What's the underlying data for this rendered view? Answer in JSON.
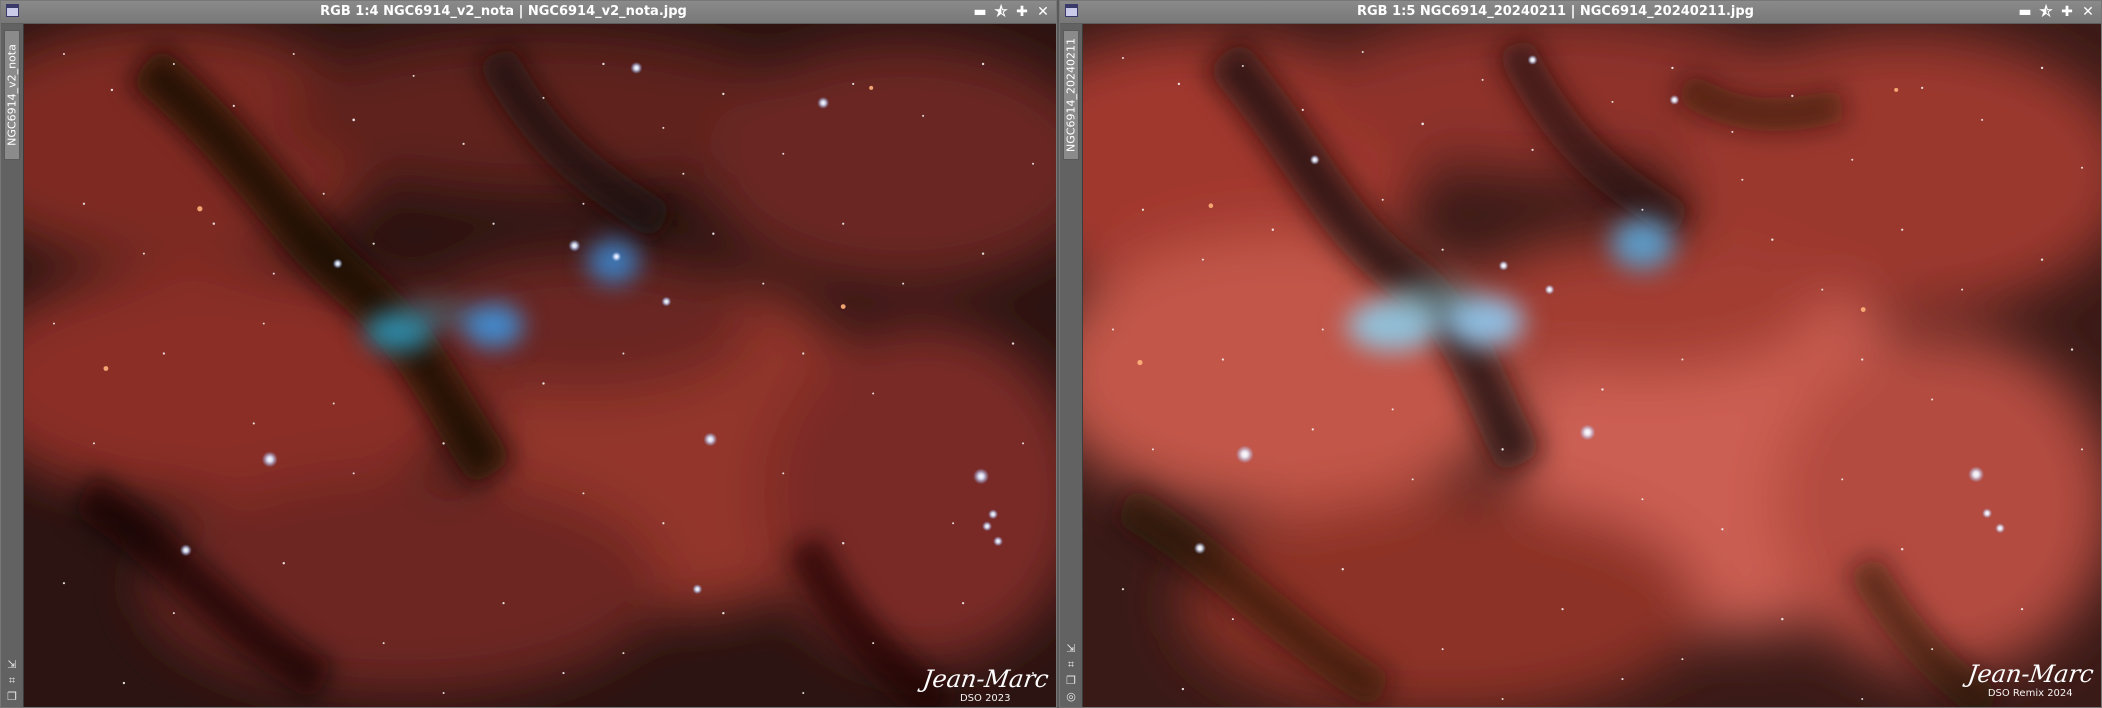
{
  "windows": [
    {
      "title": "RGB 1:4 NGC6914_v2_nota | NGC6914_v2_nota.jpg",
      "tab_label": "NGC6914_v2_nota",
      "signature": {
        "name": "Jean-Marc",
        "line": "DSO 2023"
      }
    },
    {
      "title": "RGB 1:5 NGC6914_20240211 | NGC6914_20240211.jpg",
      "tab_label": "NGC6914_20240211",
      "signature": {
        "name": "Jean-Marc",
        "line": "DSO Remix 2024"
      }
    }
  ],
  "controls": {
    "minimize": "▬",
    "shade": "⯪",
    "maximize": "✚",
    "close": "✕"
  },
  "icons": [
    "window-icon",
    "minimize-icon",
    "shade-icon",
    "maximize-icon",
    "close-icon",
    "tool-arrow-icon",
    "tool-fit-icon",
    "tool-copy-icon",
    "tool-eye-icon"
  ],
  "colors": {
    "titlebar": "#808080",
    "sidebar": "#626262",
    "nebula_red": "#a23a30",
    "nebula_bright": "#d8675a",
    "reflection_blue": "#4aa3d6",
    "dust": "#1a0d0b"
  }
}
